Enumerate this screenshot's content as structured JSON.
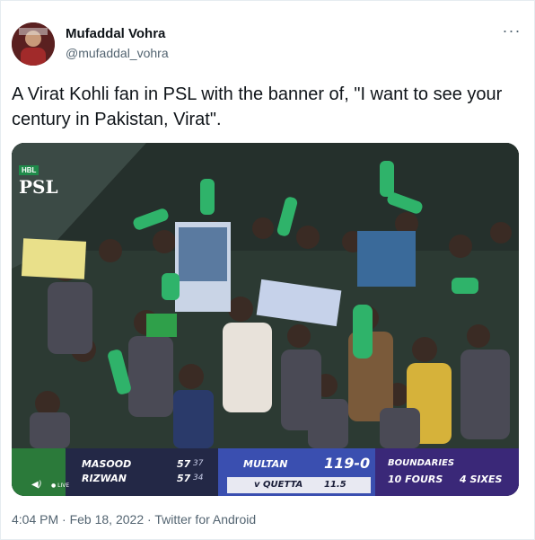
{
  "author": {
    "name": "Mufaddal Vohra",
    "handle": "@mufaddal_vohra",
    "avatar_icon": "profile-avatar"
  },
  "menu_icon": "more-horizontal-icon",
  "tweet": {
    "text": "A Virat Kohli fan in PSL with the banner of, \"I want to see your century in Pakistan, Virat\"."
  },
  "media": {
    "logo_badge": "HBL",
    "logo_text": "PSL",
    "live_label": "LIVE",
    "scoreboard": {
      "batter1_name": "MASOOD",
      "batter1_score": "57",
      "batter1_balls": "37",
      "batter2_name": "RIZWAN",
      "batter2_score": "57",
      "batter2_balls": "34",
      "team": "MULTAN",
      "score": "119-0",
      "opponent": "v QUETTA",
      "overs": "11.5",
      "stat_title": "BOUNDARIES",
      "fours": "10 FOURS",
      "sixes": "4 SIXES"
    }
  },
  "footer": {
    "time": "4:04 PM",
    "separator1": "·",
    "date": "Feb 18, 2022",
    "separator2": "·",
    "source": "Twitter for Android"
  },
  "colors": {
    "text_primary": "#0f1419",
    "text_secondary": "#536471",
    "scoreboard_navy": "#1b1f3a",
    "scoreboard_blue": "#3a4fb0",
    "scoreboard_purple": "#3a2878",
    "psl_green": "#2b7a3a"
  }
}
